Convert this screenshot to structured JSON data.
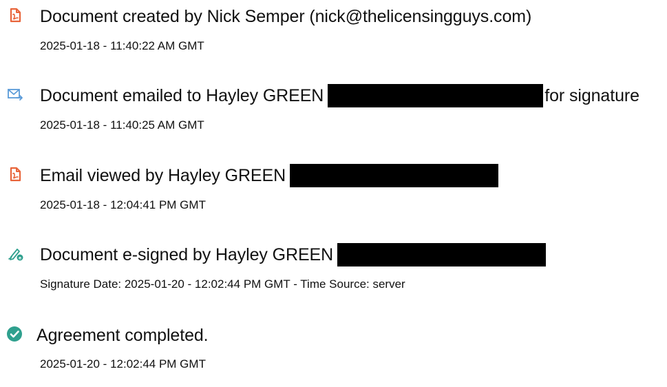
{
  "events": [
    {
      "icon": "document-pdf-icon",
      "icon_color": "#e8643a",
      "title": "Document created by Nick Semper (nick@thelicensingguys.com)",
      "subtitle": "2025-01-18 - 11:40:22 AM GMT"
    },
    {
      "icon": "email-send-icon",
      "icon_color": "#5a9bd8",
      "title_before": "Document emailed to Hayley GREEN",
      "title_after": "for signature",
      "subtitle": "2025-01-18 - 11:40:25 AM GMT"
    },
    {
      "icon": "document-pdf-icon",
      "icon_color": "#e8643a",
      "title_before": "Email viewed by Hayley GREEN",
      "subtitle": "2025-01-18 - 12:04:41 PM GMT"
    },
    {
      "icon": "e-sign-pen-icon",
      "icon_color": "#2fa08e",
      "title_before": "Document e-signed by Hayley GREEN",
      "subtitle": "Signature Date: 2025-01-20 - 12:02:44 PM GMT - Time Source: server"
    },
    {
      "icon": "check-circle-icon",
      "icon_color": "#2fa08e",
      "title": "Agreement completed.",
      "subtitle": "2025-01-20 - 12:02:44 PM GMT"
    }
  ],
  "redaction_color": "#000000"
}
